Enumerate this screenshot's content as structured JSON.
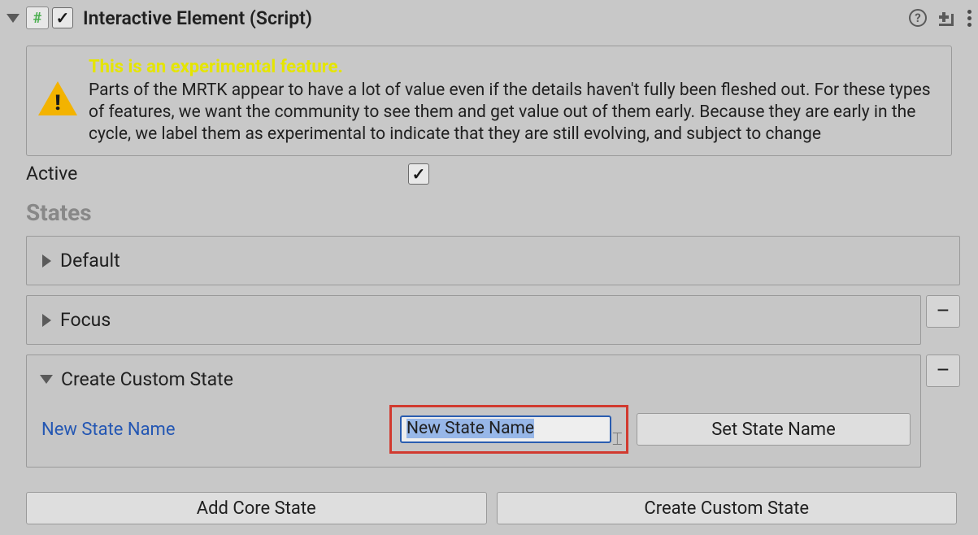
{
  "header": {
    "title": "Interactive Element (Script)",
    "enabled": true,
    "script_icon_glyph": "#"
  },
  "helpbox": {
    "title": "This is an experimental feature.",
    "body": "Parts of the MRTK appear to have a lot of value even if the details haven't fully been fleshed out. For these types of features, we want the community to see them and get value out of them early. Because they are early in the cycle, we label them as experimental to indicate that they are still evolving, and subject to change"
  },
  "active": {
    "label": "Active",
    "value": true
  },
  "states_heading": "States",
  "states": {
    "default": {
      "name": "Default",
      "expanded": false,
      "removable": false
    },
    "focus": {
      "name": "Focus",
      "expanded": false,
      "removable": true
    },
    "custom": {
      "name": "Create Custom State",
      "expanded": true,
      "removable": true,
      "new_state_label": "New State Name",
      "new_state_input_value": "New State Name",
      "set_name_button": "Set State Name"
    }
  },
  "buttons": {
    "add_core_state": "Add Core State",
    "create_custom_state": "Create Custom State",
    "remove_glyph": "–"
  }
}
